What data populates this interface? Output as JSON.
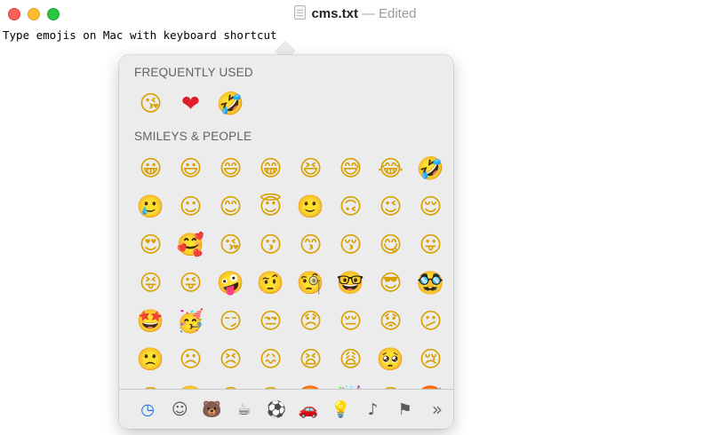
{
  "window": {
    "file_name": "cms.txt",
    "separator": "—",
    "status": "Edited"
  },
  "editor": {
    "text": "Type emojis on Mac with keyboard shortcut"
  },
  "emoji_picker": {
    "frequently_used": {
      "title": "FREQUENTLY USED",
      "emojis": [
        "😘",
        "❤",
        "🤣"
      ]
    },
    "smileys": {
      "title": "SMILEYS & PEOPLE",
      "rows": [
        [
          "😀",
          "😃",
          "😄",
          "😁",
          "😆",
          "😅",
          "😂",
          "🤣"
        ],
        [
          "🥲",
          "☺",
          "😊",
          "😇",
          "🙂",
          "🙃",
          "😉",
          "😌"
        ],
        [
          "😍",
          "🥰",
          "😘",
          "😗",
          "😙",
          "😚",
          "😋",
          "😛"
        ],
        [
          "😝",
          "😜",
          "🤪",
          "🤨",
          "🧐",
          "🤓",
          "😎",
          "🥸"
        ],
        [
          "🤩",
          "🥳",
          "😏",
          "😒",
          "😞",
          "😔",
          "😟",
          "😕"
        ],
        [
          "🙁",
          "☹",
          "😣",
          "😖",
          "😫",
          "😩",
          "🥺",
          "😢"
        ],
        [
          "😭",
          "😤",
          "😠",
          "😡",
          "🤬",
          "🤯",
          "😳",
          "🥵"
        ]
      ]
    },
    "categories": [
      {
        "name": "frequently-used",
        "glyph": "◷",
        "active": true
      },
      {
        "name": "smileys-people",
        "glyph": "☺"
      },
      {
        "name": "animals-nature",
        "glyph": "🐻"
      },
      {
        "name": "food-drink",
        "glyph": "☕"
      },
      {
        "name": "activity",
        "glyph": "⚽"
      },
      {
        "name": "travel-places",
        "glyph": "🚗"
      },
      {
        "name": "objects",
        "glyph": "💡"
      },
      {
        "name": "symbols",
        "glyph": "♪"
      },
      {
        "name": "flags",
        "glyph": "⚑"
      },
      {
        "name": "more",
        "glyph": "»"
      }
    ]
  }
}
